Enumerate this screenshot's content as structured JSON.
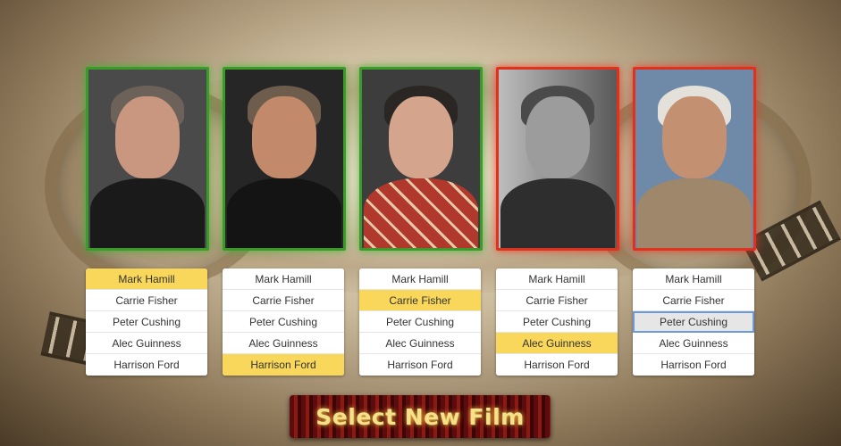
{
  "cards": [
    {
      "result": "correct",
      "options": [
        "Mark Hamill",
        "Carrie Fisher",
        "Peter Cushing",
        "Alec Guinness",
        "Harrison Ford"
      ],
      "selected_index": 0,
      "hover_index": null
    },
    {
      "result": "correct",
      "options": [
        "Mark Hamill",
        "Carrie Fisher",
        "Peter Cushing",
        "Alec Guinness",
        "Harrison Ford"
      ],
      "selected_index": 4,
      "hover_index": null
    },
    {
      "result": "correct",
      "options": [
        "Mark Hamill",
        "Carrie Fisher",
        "Peter Cushing",
        "Alec Guinness",
        "Harrison Ford"
      ],
      "selected_index": 1,
      "hover_index": null
    },
    {
      "result": "wrong",
      "options": [
        "Mark Hamill",
        "Carrie Fisher",
        "Peter Cushing",
        "Alec Guinness",
        "Harrison Ford"
      ],
      "selected_index": 3,
      "hover_index": null
    },
    {
      "result": "wrong",
      "options": [
        "Mark Hamill",
        "Carrie Fisher",
        "Peter Cushing",
        "Alec Guinness",
        "Harrison Ford"
      ],
      "selected_index": null,
      "hover_index": 2
    }
  ],
  "select_button_label": "Select New Film",
  "colors": {
    "correct_border": "#3a9a2a",
    "wrong_border": "#e0301e",
    "selected_option": "#f8d75a",
    "button_text": "#f6e08a"
  }
}
